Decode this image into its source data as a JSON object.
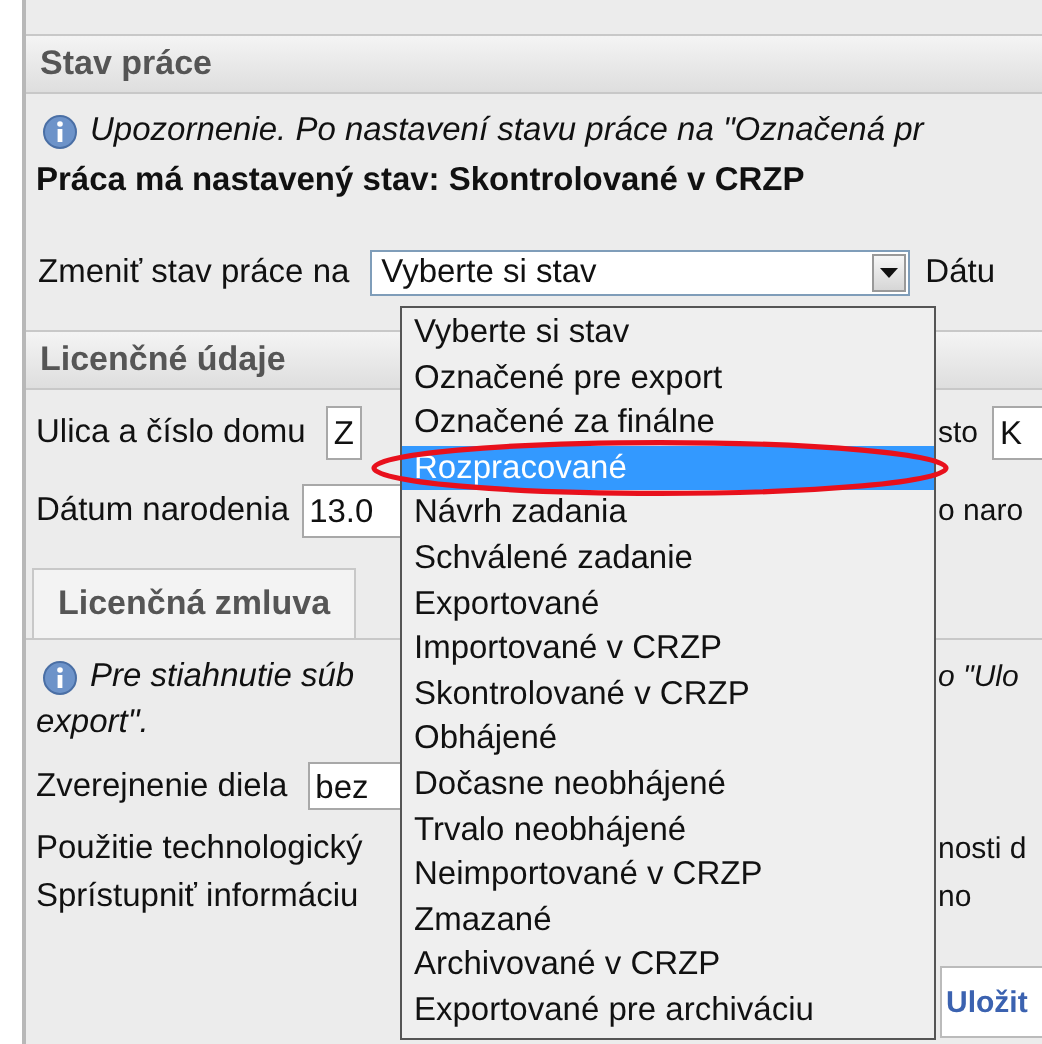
{
  "status_panel": {
    "title": "Stav práce",
    "notice": "Upozornenie. Po nastavení stavu práce na \"Označená pr",
    "current_status": "Práca má nastavený stav: Skontrolované v CRZP",
    "change_label": "Zmeniť stav práce na",
    "select_value": "Vyberte si stav",
    "date_label": "Dátu"
  },
  "status_options": [
    {
      "label": "Vyberte si stav",
      "selected": false
    },
    {
      "label": "Označené pre export",
      "selected": false
    },
    {
      "label": "Označené za finálne",
      "selected": false
    },
    {
      "label": "Rozpracované",
      "selected": true
    },
    {
      "label": "Návrh zadania",
      "selected": false
    },
    {
      "label": "Schválené zadanie",
      "selected": false
    },
    {
      "label": "Exportované",
      "selected": false
    },
    {
      "label": "Importované v CRZP",
      "selected": false
    },
    {
      "label": "Skontrolované v CRZP",
      "selected": false
    },
    {
      "label": "Obhájené",
      "selected": false
    },
    {
      "label": "Dočasne neobhájené",
      "selected": false
    },
    {
      "label": "Trvalo neobhájené",
      "selected": false
    },
    {
      "label": "Neimportované v CRZP",
      "selected": false
    },
    {
      "label": "Zmazané",
      "selected": false
    },
    {
      "label": "Archivované v CRZP",
      "selected": false
    },
    {
      "label": "Exportované pre archiváciu",
      "selected": false
    }
  ],
  "license_panel": {
    "title": "Licenčné údaje",
    "rows": [
      {
        "label": "Ulica a číslo domu",
        "value": "Z",
        "right_label": "sto",
        "right_value": "K"
      },
      {
        "label": "Dátum narodenia",
        "value": "13.0",
        "right_label": "o naro"
      }
    ]
  },
  "tabs": [
    {
      "label": "Licenčná zmluva",
      "selected": true
    }
  ],
  "contract": {
    "notice": "Pre stiahnutie súb",
    "notice_end": "o \"Ulo",
    "notice_line2": "export\".",
    "rows": [
      {
        "label": "Zverejnenie diela",
        "value": "bez"
      },
      {
        "label": "Použitie technologický",
        "right_label": "nosti d"
      },
      {
        "label": "Sprístupniť informáciu",
        "right_label": "no"
      }
    ]
  },
  "save_button": "Uložit"
}
